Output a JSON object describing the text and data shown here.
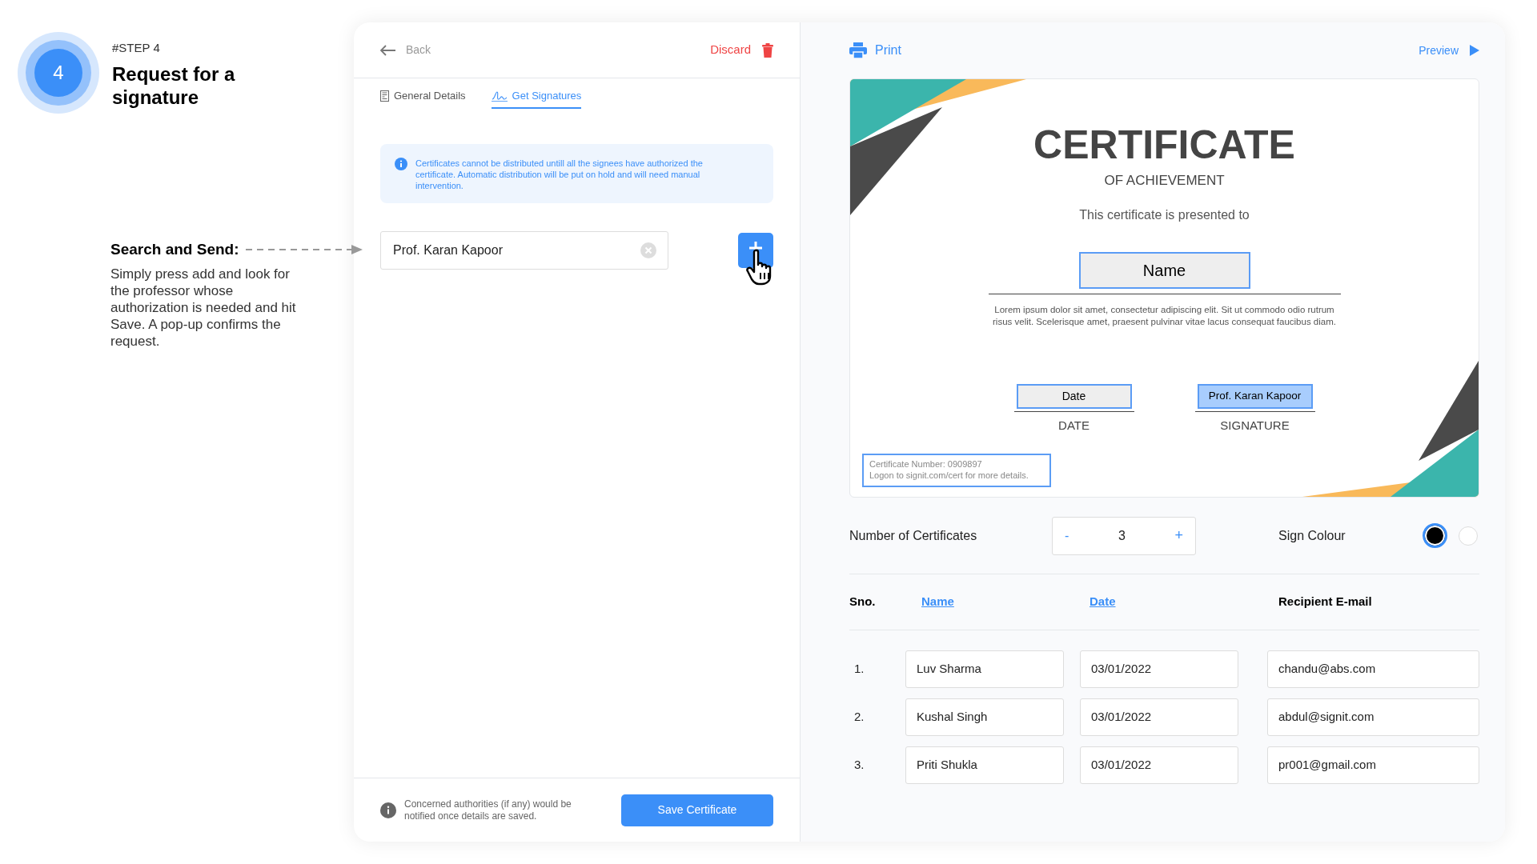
{
  "step": {
    "number": "4",
    "label": "#STEP 4",
    "title": "Request for a signature"
  },
  "annotation": {
    "heading": "Search and Send:",
    "body": "Simply press add and look for the professor whose authorization is needed and hit Save. A pop-up confirms the request."
  },
  "header": {
    "back": "Back",
    "discard": "Discard"
  },
  "tabs": [
    {
      "label": "General Details",
      "selected": false
    },
    {
      "label": "Get Signatures",
      "selected": true
    }
  ],
  "notice": "Certificates cannot be distributed untill all the signees have authorized the certificate. Automatic distribution will be put on hold and will need manual intervention.",
  "search": {
    "value": "Prof. Karan Kapoor"
  },
  "footer": {
    "note": "Concerned authorities (if any) would be notified once details are saved.",
    "save": "Save Certificate"
  },
  "toolbar": {
    "print": "Print",
    "preview": "Preview"
  },
  "certificate": {
    "title": "CERTIFICATE",
    "subtitle": "OF ACHIEVEMENT",
    "presented": "This certificate is presented to",
    "name_field": "Name",
    "body": "Lorem ipsum dolor sit amet, consectetur adipiscing elit. Sit ut commodo odio rutrum risus velit. Scelerisque amet, praesent pulvinar vitae lacus consequat faucibus diam.",
    "date_field": "Date",
    "date_label": "DATE",
    "signature_field": "Prof. Karan Kapoor",
    "signature_label": "SIGNATURE",
    "number_line": "Certificate Number: 0909897",
    "logon_line": "Logon to signit.com/cert for more details."
  },
  "count": {
    "label": "Number of Certificates",
    "minus": "-",
    "value": "3",
    "plus": "+"
  },
  "sign_colour": {
    "label": "Sign Colour",
    "options": [
      {
        "color": "#000000",
        "selected": true
      },
      {
        "color": "#ffffff",
        "selected": false
      }
    ]
  },
  "table": {
    "columns": [
      {
        "label": "Sno.",
        "link": false
      },
      {
        "label": "Name",
        "link": true
      },
      {
        "label": "Date",
        "link": true
      },
      {
        "label": "Recipient E-mail",
        "link": false
      }
    ],
    "rows": [
      [
        "1.",
        "Luv Sharma",
        "03/01/2022",
        "chandu@abs.com"
      ],
      [
        "2.",
        "Kushal Singh",
        "03/01/2022",
        "abdul@signit.com"
      ],
      [
        "3.",
        "Priti Shukla",
        "03/01/2022",
        "pr001@gmail.com"
      ]
    ]
  }
}
